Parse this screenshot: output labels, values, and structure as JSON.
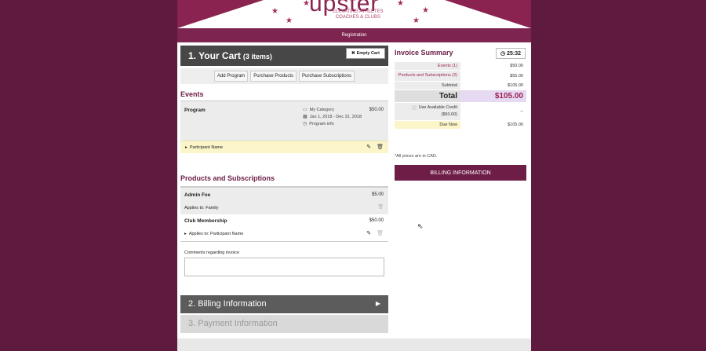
{
  "banner": {
    "logo": "upster",
    "tagline_1": "ELEVATING ATHLETES",
    "tagline_2": "COACHES & CLUBS"
  },
  "nav": {
    "registration": "Registration"
  },
  "cart": {
    "title": "1. Your Cart",
    "count": "(3 items)",
    "empty_label": "Empty Cart",
    "actions": [
      "Add Program",
      "Purchase Products",
      "Purchase Subscriptions"
    ]
  },
  "events": {
    "heading": "Events",
    "item": {
      "name": "Program",
      "category": "My Category",
      "dates": "Jan 1, 2018 - Dec 31, 2018",
      "info": "Program info",
      "price": "$50.00",
      "participant": "Participant Name"
    }
  },
  "products": {
    "heading": "Products and Subscriptions",
    "items": [
      {
        "name": "Admin Fee",
        "price": "$5.00",
        "applies": "Applies to:  Family"
      },
      {
        "name": "Club Membership",
        "price": "$50.00",
        "applies": "Applies to:  Participant Name"
      }
    ],
    "comments_label": "Comments regarding invoice",
    "comments_value": ""
  },
  "steps": {
    "billing": "2. Billing Information",
    "payment": "3. Payment Information"
  },
  "invoice": {
    "title": "Invoice Summary",
    "timer": "25:32",
    "rows": {
      "events_label": "Events (1)",
      "events_value": "$50.00",
      "products_label": "Products and Subscriptions (2)",
      "products_value": "$55.00",
      "subtotal_label": "Subtotal",
      "subtotal_value": "$105.00",
      "total_label": "Total",
      "total_value": "$105.00",
      "credit_label": "Use Available Credit ($50.00)",
      "credit_value": "--",
      "due_label": "Due Now",
      "due_value": "$105.00"
    },
    "currency_note": "*All prices are in CAD.",
    "billing_button": "BILLING INFORMATION"
  },
  "colors": {
    "background": "#5e1a3f",
    "brand": "#6e1d47",
    "accent": "#9b2056"
  }
}
